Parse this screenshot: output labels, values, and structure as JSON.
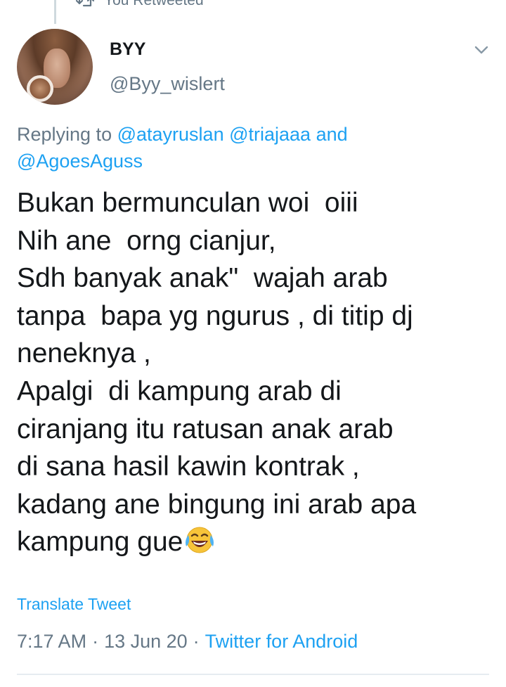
{
  "retweet": {
    "icon": "retweet-icon",
    "label": "You Retweeted"
  },
  "author": {
    "name": "BYY",
    "handle": "@Byy_wislert",
    "avatar": "avatar"
  },
  "reply": {
    "prefix": "Replying to",
    "mention_1": "@atayruslan",
    "mention_2": "@triajaaa",
    "conjunction": "and",
    "mention_3": "@AgoesAguss"
  },
  "tweet": {
    "body": "Bukan bermunculan woi  oiii\nNih ane  orng cianjur,\nSdh banyak anak\"  wajah arab\ntanpa  bapa yg ngurus , di titip dj\nneneknya ,\nApalgi  di kampung arab di\nciranjang itu ratusan anak arab\ndi sana hasil kawin kontrak ,\nkadang ane bingung ini arab apa\nkampung gue",
    "emoji": "face-with-tears-of-joy",
    "translate_label": "Translate Tweet",
    "time": "7:17 AM",
    "separator_1": "·",
    "date": "13 Jun 20",
    "separator_2": "·",
    "source": "Twitter for Android"
  },
  "colors": {
    "accent": "#1da1f2",
    "secondary_text": "#657786",
    "primary_text": "#14171a"
  }
}
